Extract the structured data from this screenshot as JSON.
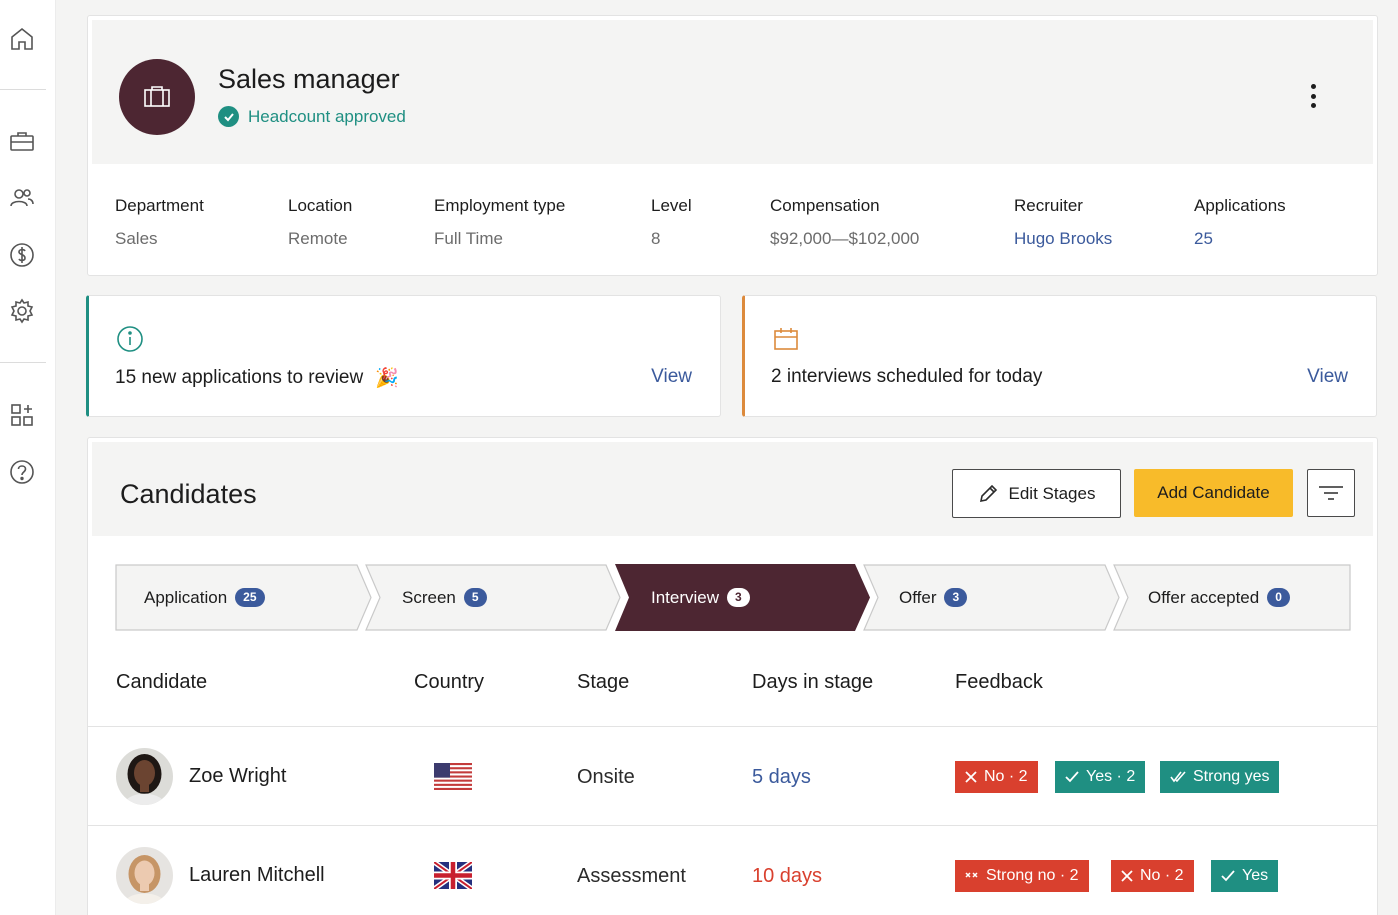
{
  "sidebar": {
    "icons": [
      "home-icon",
      "briefcase-icon",
      "people-icon",
      "dollar-icon",
      "settings-icon",
      "apps-add-icon",
      "help-icon"
    ]
  },
  "job": {
    "title": "Sales manager",
    "status": "Headcount approved",
    "fields": [
      {
        "label": "Department",
        "value": "Sales"
      },
      {
        "label": "Location",
        "value": "Remote"
      },
      {
        "label": "Employment type",
        "value": "Full Time"
      },
      {
        "label": "Level",
        "value": "8"
      },
      {
        "label": "Compensation",
        "value": "$92,000—$102,000"
      },
      {
        "label": "Recruiter",
        "value": "Hugo Brooks"
      },
      {
        "label": "Applications",
        "value": "25"
      }
    ]
  },
  "notices": [
    {
      "text": "15 new applications to review",
      "emoji": "🎉",
      "action": "View"
    },
    {
      "text": "2 interviews scheduled for today",
      "action": "View"
    }
  ],
  "candidates": {
    "title": "Candidates",
    "edit_label": "Edit Stages",
    "add_label": "Add Candidate",
    "stages": [
      {
        "label": "Application",
        "count": "25"
      },
      {
        "label": "Screen",
        "count": "5"
      },
      {
        "label": "Interview",
        "count": "3",
        "active": true
      },
      {
        "label": "Offer",
        "count": "3"
      },
      {
        "label": "Offer accepted",
        "count": "0"
      }
    ],
    "columns": [
      "Candidate",
      "Country",
      "Stage",
      "Days in stage",
      "Feedback"
    ],
    "rows": [
      {
        "name": "Zoe Wright",
        "country_flag": "us-flag-icon",
        "stage": "Onsite",
        "days": "5 days",
        "feedback": [
          {
            "icon": "x-icon",
            "label": "No · 2"
          },
          {
            "icon": "check-icon",
            "label": "Yes · 2"
          },
          {
            "icon": "double-check-icon",
            "label": "Strong yes"
          }
        ]
      },
      {
        "name": "Lauren Mitchell",
        "country_flag": "uk-flag-icon",
        "stage": "Assessment",
        "days": "10 days",
        "feedback": [
          {
            "icon": "double-x-icon",
            "label": "Strong no · 2"
          },
          {
            "icon": "x-icon",
            "label": "No · 2"
          },
          {
            "icon": "check-icon",
            "label": "Yes"
          }
        ]
      }
    ]
  },
  "colors": {
    "brand": "#4d2632",
    "teal": "#1f8f82",
    "link": "#3b5a9c",
    "accent_yellow": "#f8bb2a",
    "danger": "#d9402e",
    "warning": "#dc8a3c"
  }
}
